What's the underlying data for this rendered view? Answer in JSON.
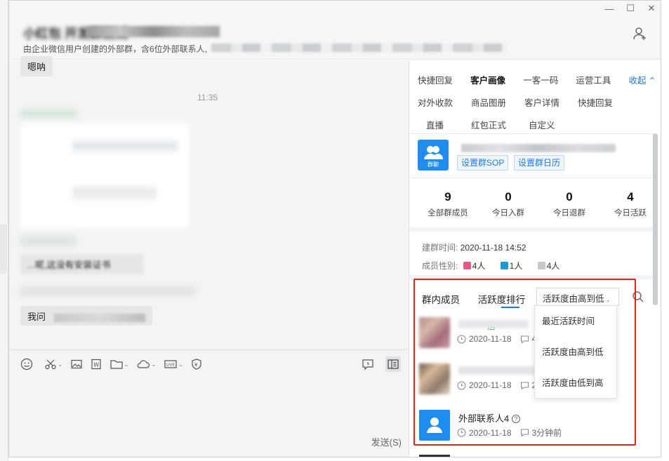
{
  "window": {
    "title": "小红包 开发群测试",
    "subtitle": "由企业微信用户创建的外部群，含6位外部联系人,"
  },
  "chat": {
    "messages": [
      {
        "text": "嗯呐"
      },
      {
        "text": "11:35",
        "kind": "time"
      },
      {
        "text": "...呢,这没有安装证书"
      },
      {
        "text": "我问"
      }
    ]
  },
  "input": {
    "send_label": "发送(S)"
  },
  "panel": {
    "tabs_row1": [
      "快捷回复",
      "客户画像",
      "一客一码",
      "运营工具",
      "收起 ⌃"
    ],
    "tabs_row2": [
      "对外收款",
      "商品图册",
      "客户详情",
      "快捷回复"
    ],
    "tabs_row3": [
      "直播",
      "红包正式",
      "自定义"
    ],
    "active_tab": "客户画像",
    "group": {
      "avatar_label": "群聊",
      "sop_button": "设置群SOP",
      "calendar_button": "设置群日历"
    },
    "stats": [
      {
        "value": "9",
        "label": "全部群成员"
      },
      {
        "value": "0",
        "label": "今日入群"
      },
      {
        "value": "0",
        "label": "今日退群"
      },
      {
        "value": "4",
        "label": "今日活跃"
      }
    ],
    "created_label": "建群时间:",
    "created_value": "2020-11-18 14:52",
    "gender_label": "成员性别:",
    "gender_female": "4人",
    "gender_male": "1人",
    "gender_unknown": "4人",
    "member_tab_members": "群内成员",
    "member_tab_activity": "活跃度排行",
    "sort_selected": "活跃度由高到低",
    "sort_options": [
      "最近活跃时间",
      "活跃度由高到低",
      "活跃度由低到高"
    ],
    "members": [
      {
        "name": "信",
        "date": "2020-11-18",
        "msgs": "48"
      },
      {
        "name": "",
        "date": "2020-11-18",
        "msgs": "29"
      },
      {
        "name": "外部联系人4",
        "date": "2020-11-18",
        "msgs": "3分钟前"
      }
    ]
  },
  "colors": {
    "accent": "#1f7bd6",
    "avatar_blue": "#1f8df0",
    "highlight_red": "#d9261c",
    "female": "#e8578a",
    "male": "#1a9bd7"
  }
}
